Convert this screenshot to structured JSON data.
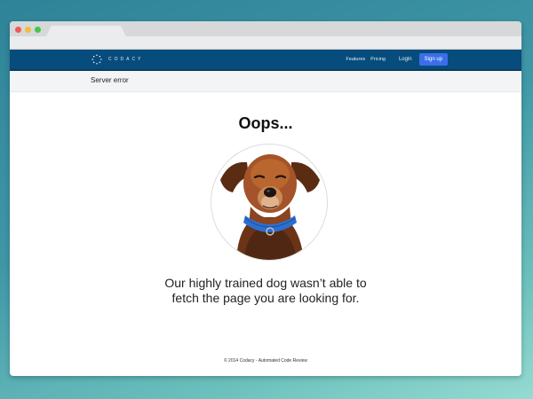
{
  "colors": {
    "navbar_bg": "#064c7c",
    "signup_bg": "#3b6ee8",
    "window_close": "#ee5b57",
    "window_minimize": "#f4bd3a",
    "window_maximize": "#43c74a"
  },
  "navbar": {
    "logo_text": "CODACY",
    "links": [
      "Features",
      "Pricing"
    ],
    "login_label": "Login",
    "signup_label": "Sign up"
  },
  "subheader": {
    "title": "Server error"
  },
  "main": {
    "heading": "Oops...",
    "message_line1": "Our highly trained dog wasn’t able to",
    "message_line2": "fetch the page you are looking for.",
    "image_icon": "dog-photo"
  },
  "footer": {
    "text": "© 2014 Codacy - Automated Code Review"
  }
}
